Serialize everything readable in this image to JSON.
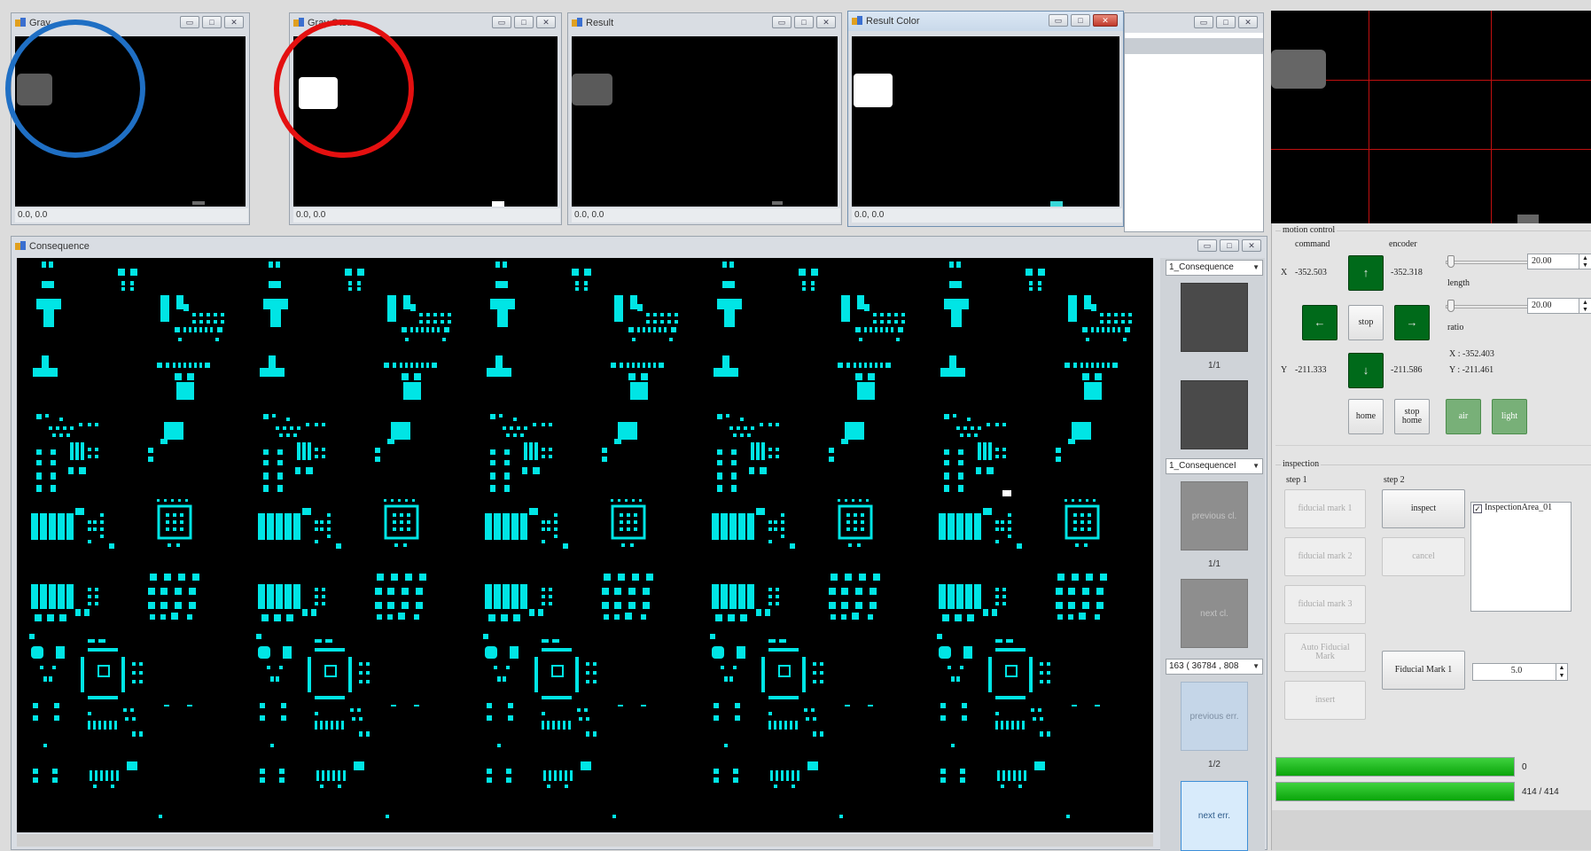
{
  "windows": {
    "gray": {
      "title": "Gray",
      "coords": "0.0, 0.0"
    },
    "gray_otsu": {
      "title": "Gray Otsu",
      "coords": "0.0, 0.0"
    },
    "result": {
      "title": "Result",
      "coords": "0.0, 0.0"
    },
    "result_color": {
      "title": "Result Color",
      "coords": "0.0, 0.0"
    },
    "consequence": {
      "title": "Consequence"
    }
  },
  "window_controls": {
    "minimize": "▭",
    "maximize": "□",
    "close": "✕"
  },
  "consequence_side": {
    "combo1": "1_Consequence",
    "page1": "1/1",
    "combo2": "1_ConsequenceI",
    "prev_cl": "previous cl.",
    "page2": "1/1",
    "next_cl": "next cl.",
    "combo3": "163 ( 36784 , 808",
    "prev_err": "previous err.",
    "page3": "1/2",
    "next_err": "next err."
  },
  "motion": {
    "title": "motion control",
    "command_label": "command",
    "encoder_label": "encoder",
    "x_label": "X",
    "x_command": "-352.503",
    "x_encoder": "-352.318",
    "y_label": "Y",
    "y_command": "-211.333",
    "y_encoder": "-211.586",
    "up": "↑",
    "down": "↓",
    "left": "←",
    "right": "→",
    "stop": "stop",
    "home": "home",
    "stop_home": "stop home",
    "air": "air",
    "light": "light",
    "length_label": "length",
    "length_value": "20.00",
    "ratio_label": "ratio",
    "ratio_value": "20.00",
    "pos_x": "X : -352.403",
    "pos_y": "Y : -211.461"
  },
  "inspection": {
    "title": "inspection",
    "step1": "step 1",
    "step2": "step 2",
    "fiducial1": "fiducial mark 1",
    "fiducial2": "fiducial mark 2",
    "fiducial3": "fiducial mark 3",
    "auto_fiducial": "Auto Fiducial Mark",
    "insert": "insert",
    "inspect": "inspect",
    "cancel": "cancel",
    "fiducial_mark_btn": "Fiducial Mark 1",
    "spin_value": "5.0",
    "list_item": "InspectionArea_01",
    "progress1_label": "0",
    "progress1": 1.0,
    "progress2_label": "414 / 414",
    "progress2": 1.0
  },
  "colors": {
    "annotation_blue": "#1f6fc4",
    "annotation_red": "#e41010",
    "pattern": "#00e5e5"
  }
}
